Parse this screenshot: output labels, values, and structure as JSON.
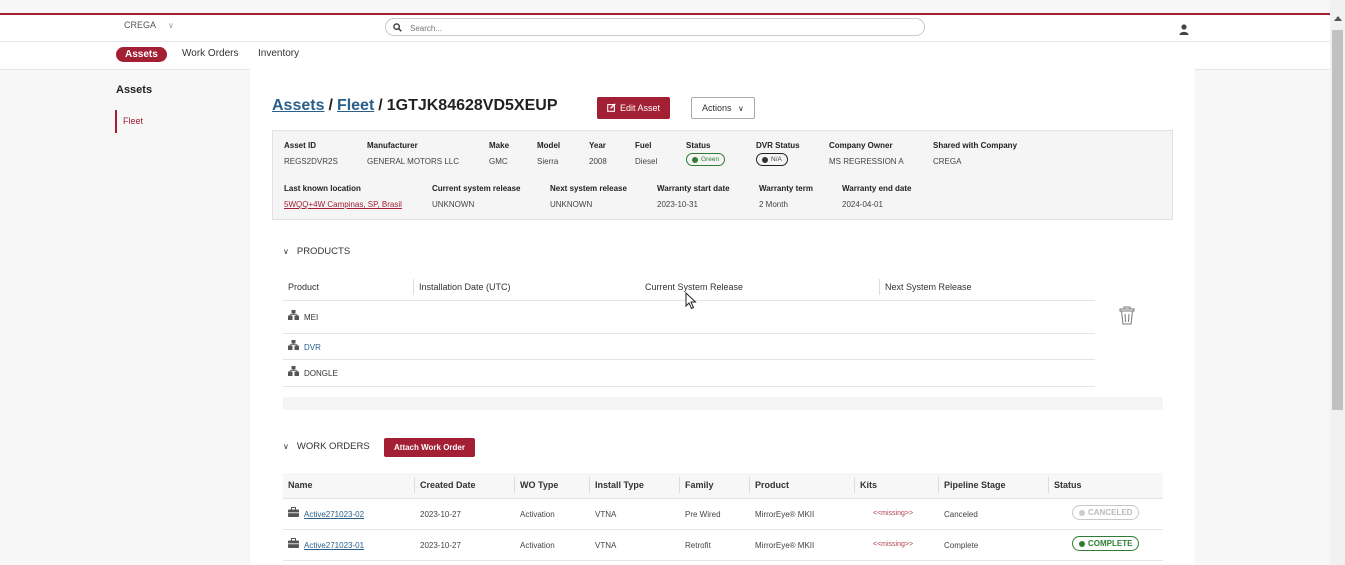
{
  "topbar": {
    "company": "CREGA",
    "search_placeholder": "Search...",
    "icons": {
      "company_dropdown": "chevron-down-icon",
      "search": "search-icon",
      "user": "user-icon"
    }
  },
  "nav": {
    "tabs": [
      "Assets",
      "Work Orders",
      "Inventory"
    ],
    "active": "Assets"
  },
  "sidebar": {
    "title": "Assets",
    "items": [
      "Fleet"
    ]
  },
  "header": {
    "crumbs": [
      "Assets",
      "Fleet"
    ],
    "separator": "/",
    "current": "1GTJK84628VD5XEUP",
    "edit_label": "Edit Asset",
    "actions_label": "Actions",
    "icons": {
      "edit": "edit-icon",
      "actions": "chevron-down-icon"
    }
  },
  "info": {
    "asset_id": {
      "label": "Asset ID",
      "value": "REGS2DVR2S"
    },
    "manufacturer": {
      "label": "Manufacturer",
      "value": "GENERAL MOTORS LLC"
    },
    "make": {
      "label": "Make",
      "value": "GMC"
    },
    "model": {
      "label": "Model",
      "value": "Sierra"
    },
    "year": {
      "label": "Year",
      "value": "2008"
    },
    "fuel": {
      "label": "Fuel",
      "value": "Diesel"
    },
    "status": {
      "label": "Status",
      "value": "Green",
      "color": "#2e7d32"
    },
    "dvr_status": {
      "label": "DVR Status",
      "value": "N/A",
      "color": "#333333"
    },
    "company_owner": {
      "label": "Company Owner",
      "value": "MS REGRESSION A"
    },
    "shared": {
      "label": "Shared with Company",
      "value": "CREGA"
    },
    "location": {
      "label": "Last known location",
      "value": "5WQQ+4W Campinas, SP, Brasil"
    },
    "current_release": {
      "label": "Current system release",
      "value": "UNKNOWN"
    },
    "next_release": {
      "label": "Next system release",
      "value": "UNKNOWN"
    },
    "warranty_start": {
      "label": "Warranty start date",
      "value": "2023-10-31"
    },
    "warranty_term": {
      "label": "Warranty term",
      "value": "2 Month"
    },
    "warranty_end": {
      "label": "Warranty end date",
      "value": "2024-04-01"
    }
  },
  "products": {
    "title": "PRODUCTS",
    "headers": [
      "Product",
      "Installation Date (UTC)",
      "Current System Release",
      "Next System Release"
    ],
    "rows": [
      {
        "name": "MEI",
        "color": "#333333"
      },
      {
        "name": "DVR",
        "color": "#2a5f8a"
      },
      {
        "name": "DONGLE",
        "color": "#333333"
      }
    ],
    "icons": {
      "product": "product-hierarchy-icon",
      "delete": "trash-icon"
    }
  },
  "work_orders": {
    "title": "WORK ORDERS",
    "attach_label": "Attach Work Order",
    "headers": [
      "Name",
      "Created Date",
      "WO Type",
      "Install Type",
      "Family",
      "Product",
      "Kits",
      "Pipeline Stage",
      "Status"
    ],
    "rows": [
      {
        "name": "Active271023-02",
        "created": "2023-10-27",
        "wo_type": "Activation",
        "install_type": "VTNA",
        "family": "Pre Wired",
        "product": "MirrorEye® MKII",
        "kits": "<<missing>>",
        "stage": "Canceled",
        "status": "CANCELED"
      },
      {
        "name": "Active271023-01",
        "created": "2023-10-27",
        "wo_type": "Activation",
        "install_type": "VTNA",
        "family": "Retrofit",
        "product": "MirrorEye® MKII",
        "kits": "<<missing>>",
        "stage": "Complete",
        "status": "COMPLETE"
      }
    ],
    "icons": {
      "work_order": "briefcase-icon"
    }
  },
  "colors": {
    "brand": "#a31f34",
    "link": "#2a5f8a",
    "complete": "#2e7d32",
    "canceled": "#bbbbbb"
  }
}
